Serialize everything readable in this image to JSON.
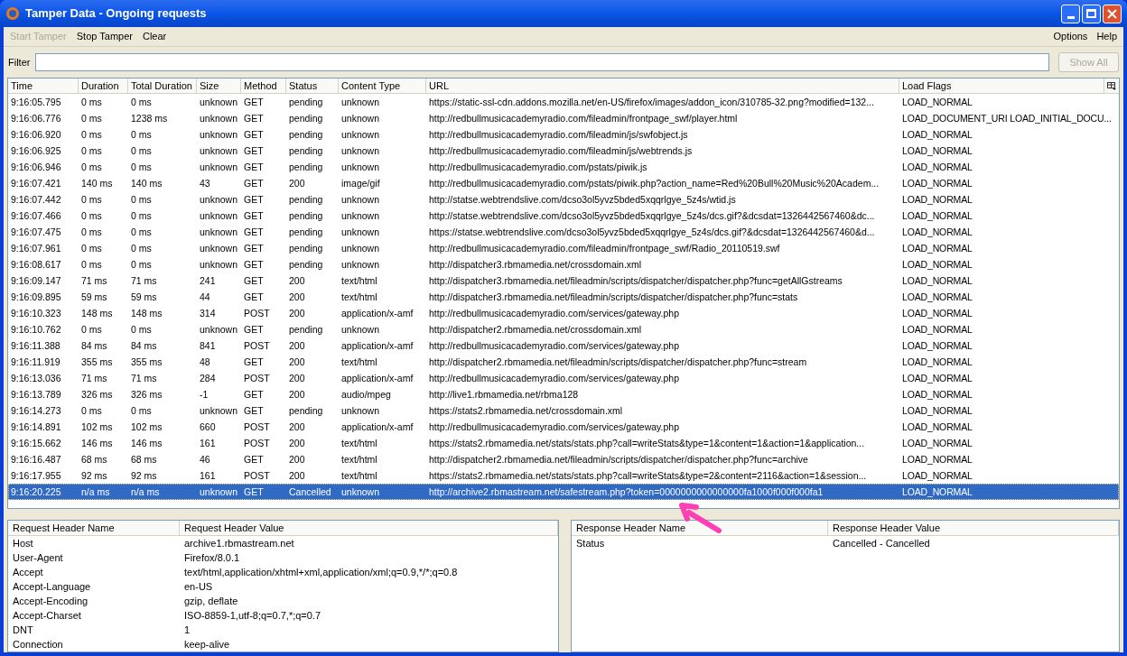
{
  "window": {
    "title": "Tamper Data - Ongoing requests"
  },
  "toolbar": [
    {
      "label": "Start Tamper",
      "disabled": true
    },
    {
      "label": "Stop Tamper",
      "disabled": false
    },
    {
      "label": "Clear",
      "disabled": false
    }
  ],
  "menu": [
    "Options",
    "Help"
  ],
  "filter": {
    "label": "Filter",
    "button": "Show All"
  },
  "table": {
    "columns": [
      "Time",
      "Duration",
      "Total Duration",
      "Size",
      "Method",
      "Status",
      "Content Type",
      "URL",
      "Load Flags"
    ],
    "rows": [
      {
        "selected": false,
        "cells": [
          "9:16:05.795",
          "0 ms",
          "0 ms",
          "unknown",
          "GET",
          "pending",
          "unknown",
          "https://static-ssl-cdn.addons.mozilla.net/en-US/firefox/images/addon_icon/310785-32.png?modified=132...",
          "LOAD_NORMAL"
        ]
      },
      {
        "selected": false,
        "cells": [
          "9:16:06.776",
          "0 ms",
          "1238 ms",
          "unknown",
          "GET",
          "pending",
          "unknown",
          "http://redbullmusicacademyradio.com/fileadmin/frontpage_swf/player.html",
          "LOAD_DOCUMENT_URI  LOAD_INITIAL_DOCU..."
        ]
      },
      {
        "selected": false,
        "cells": [
          "9:16:06.920",
          "0 ms",
          "0 ms",
          "unknown",
          "GET",
          "pending",
          "unknown",
          "http://redbullmusicacademyradio.com/fileadmin/js/swfobject.js",
          "LOAD_NORMAL"
        ]
      },
      {
        "selected": false,
        "cells": [
          "9:16:06.925",
          "0 ms",
          "0 ms",
          "unknown",
          "GET",
          "pending",
          "unknown",
          "http://redbullmusicacademyradio.com/fileadmin/js/webtrends.js",
          "LOAD_NORMAL"
        ]
      },
      {
        "selected": false,
        "cells": [
          "9:16:06.946",
          "0 ms",
          "0 ms",
          "unknown",
          "GET",
          "pending",
          "unknown",
          "http://redbullmusicacademyradio.com/pstats/piwik.js",
          "LOAD_NORMAL"
        ]
      },
      {
        "selected": false,
        "cells": [
          "9:16:07.421",
          "140 ms",
          "140 ms",
          "43",
          "GET",
          "200",
          "image/gif",
          "http://redbullmusicacademyradio.com/pstats/piwik.php?action_name=Red%20Bull%20Music%20Academ...",
          "LOAD_NORMAL"
        ]
      },
      {
        "selected": false,
        "cells": [
          "9:16:07.442",
          "0 ms",
          "0 ms",
          "unknown",
          "GET",
          "pending",
          "unknown",
          "http://statse.webtrendslive.com/dcso3ol5yvz5bded5xqqrlgye_5z4s/wtid.js",
          "LOAD_NORMAL"
        ]
      },
      {
        "selected": false,
        "cells": [
          "9:16:07.466",
          "0 ms",
          "0 ms",
          "unknown",
          "GET",
          "pending",
          "unknown",
          "http://statse.webtrendslive.com/dcso3ol5yvz5bded5xqqrlgye_5z4s/dcs.gif?&dcsdat=1326442567460&dc...",
          "LOAD_NORMAL"
        ]
      },
      {
        "selected": false,
        "cells": [
          "9:16:07.475",
          "0 ms",
          "0 ms",
          "unknown",
          "GET",
          "pending",
          "unknown",
          "https://statse.webtrendslive.com/dcso3ol5yvz5bded5xqqrlgye_5z4s/dcs.gif?&dcsdat=1326442567460&d...",
          "LOAD_NORMAL"
        ]
      },
      {
        "selected": false,
        "cells": [
          "9:16:07.961",
          "0 ms",
          "0 ms",
          "unknown",
          "GET",
          "pending",
          "unknown",
          "http://redbullmusicacademyradio.com/fileadmin/frontpage_swf/Radio_20110519.swf",
          "LOAD_NORMAL"
        ]
      },
      {
        "selected": false,
        "cells": [
          "9:16:08.617",
          "0 ms",
          "0 ms",
          "unknown",
          "GET",
          "pending",
          "unknown",
          "http://dispatcher3.rbmamedia.net/crossdomain.xml",
          "LOAD_NORMAL"
        ]
      },
      {
        "selected": false,
        "cells": [
          "9:16:09.147",
          "71 ms",
          "71 ms",
          "241",
          "GET",
          "200",
          "text/html",
          "http://dispatcher3.rbmamedia.net/fileadmin/scripts/dispatcher/dispatcher.php?func=getAllGstreams",
          "LOAD_NORMAL"
        ]
      },
      {
        "selected": false,
        "cells": [
          "9:16:09.895",
          "59 ms",
          "59 ms",
          "44",
          "GET",
          "200",
          "text/html",
          "http://dispatcher3.rbmamedia.net/fileadmin/scripts/dispatcher/dispatcher.php?func=stats",
          "LOAD_NORMAL"
        ]
      },
      {
        "selected": false,
        "cells": [
          "9:16:10.323",
          "148 ms",
          "148 ms",
          "314",
          "POST",
          "200",
          "application/x-amf",
          "http://redbullmusicacademyradio.com/services/gateway.php",
          "LOAD_NORMAL"
        ]
      },
      {
        "selected": false,
        "cells": [
          "9:16:10.762",
          "0 ms",
          "0 ms",
          "unknown",
          "GET",
          "pending",
          "unknown",
          "http://dispatcher2.rbmamedia.net/crossdomain.xml",
          "LOAD_NORMAL"
        ]
      },
      {
        "selected": false,
        "cells": [
          "9:16:11.388",
          "84 ms",
          "84 ms",
          "841",
          "POST",
          "200",
          "application/x-amf",
          "http://redbullmusicacademyradio.com/services/gateway.php",
          "LOAD_NORMAL"
        ]
      },
      {
        "selected": false,
        "cells": [
          "9:16:11.919",
          "355 ms",
          "355 ms",
          "48",
          "GET",
          "200",
          "text/html",
          "http://dispatcher2.rbmamedia.net/fileadmin/scripts/dispatcher/dispatcher.php?func=stream",
          "LOAD_NORMAL"
        ]
      },
      {
        "selected": false,
        "cells": [
          "9:16:13.036",
          "71 ms",
          "71 ms",
          "284",
          "POST",
          "200",
          "application/x-amf",
          "http://redbullmusicacademyradio.com/services/gateway.php",
          "LOAD_NORMAL"
        ]
      },
      {
        "selected": false,
        "cells": [
          "9:16:13.789",
          "326 ms",
          "326 ms",
          "-1",
          "GET",
          "200",
          "audio/mpeg",
          "http://live1.rbmamedia.net/rbma128",
          "LOAD_NORMAL"
        ]
      },
      {
        "selected": false,
        "cells": [
          "9:16:14.273",
          "0 ms",
          "0 ms",
          "unknown",
          "GET",
          "pending",
          "unknown",
          "https://stats2.rbmamedia.net/crossdomain.xml",
          "LOAD_NORMAL"
        ]
      },
      {
        "selected": false,
        "cells": [
          "9:16:14.891",
          "102 ms",
          "102 ms",
          "660",
          "POST",
          "200",
          "application/x-amf",
          "http://redbullmusicacademyradio.com/services/gateway.php",
          "LOAD_NORMAL"
        ]
      },
      {
        "selected": false,
        "cells": [
          "9:16:15.662",
          "146 ms",
          "146 ms",
          "161",
          "POST",
          "200",
          "text/html",
          "https://stats2.rbmamedia.net/stats/stats.php?call=writeStats&type=1&content=1&action=1&application...",
          "LOAD_NORMAL"
        ]
      },
      {
        "selected": false,
        "cells": [
          "9:16:16.487",
          "68 ms",
          "68 ms",
          "46",
          "GET",
          "200",
          "text/html",
          "http://dispatcher2.rbmamedia.net/fileadmin/scripts/dispatcher/dispatcher.php?func=archive",
          "LOAD_NORMAL"
        ]
      },
      {
        "selected": false,
        "cells": [
          "9:16:17.955",
          "92 ms",
          "92 ms",
          "161",
          "POST",
          "200",
          "text/html",
          "https://stats2.rbmamedia.net/stats/stats.php?call=writeStats&type=2&content=2116&action=1&session...",
          "LOAD_NORMAL"
        ]
      },
      {
        "selected": true,
        "cells": [
          "9:16:20.225",
          "n/a ms",
          "n/a ms",
          "unknown",
          "GET",
          "Cancelled",
          "unknown",
          "http://archive2.rbmastream.net/safestream.php?token=0000000000000000fa1000f000f000fa1",
          "LOAD_NORMAL"
        ]
      }
    ]
  },
  "request_headers": {
    "columns": [
      "Request Header Name",
      "Request Header Value"
    ],
    "rows": [
      [
        "Host",
        "archive1.rbmastream.net"
      ],
      [
        "User-Agent",
        "Firefox/8.0.1"
      ],
      [
        "Accept",
        "text/html,application/xhtml+xml,application/xml;q=0.9,*/*;q=0.8"
      ],
      [
        "Accept-Language",
        "en-US"
      ],
      [
        "Accept-Encoding",
        "gzip, deflate"
      ],
      [
        "Accept-Charset",
        "ISO-8859-1,utf-8;q=0.7,*;q=0.7"
      ],
      [
        "DNT",
        "1"
      ],
      [
        "Connection",
        "keep-alive"
      ]
    ]
  },
  "response_headers": {
    "columns": [
      "Response Header Name",
      "Response Header Value"
    ],
    "rows": [
      [
        "Status",
        "Cancelled - Cancelled"
      ]
    ]
  }
}
